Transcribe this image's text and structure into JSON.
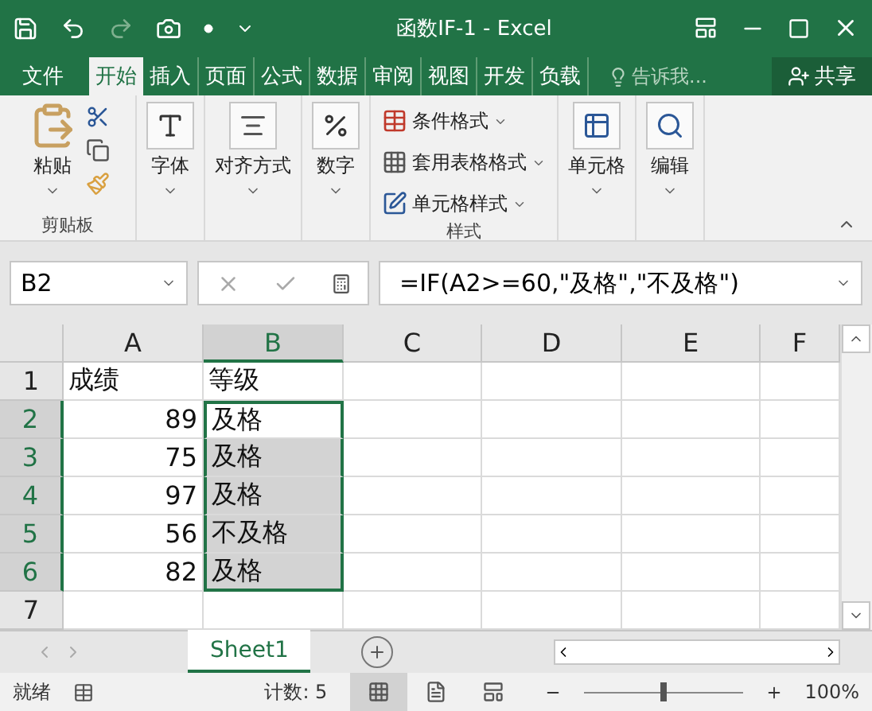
{
  "title": "函数IF-1 - Excel",
  "ribbon_tabs": [
    {
      "label": "文件",
      "selected": false
    },
    {
      "label": "开始",
      "selected": true
    },
    {
      "label": "插入",
      "selected": false
    },
    {
      "label": "页面",
      "selected": false
    },
    {
      "label": "公式",
      "selected": false
    },
    {
      "label": "数据",
      "selected": false
    },
    {
      "label": "审阅",
      "selected": false
    },
    {
      "label": "视图",
      "selected": false
    },
    {
      "label": "开发",
      "selected": false
    },
    {
      "label": "负载",
      "selected": false
    }
  ],
  "tell_me": "告诉我...",
  "share": "共享",
  "clipboard": {
    "paste": "粘贴",
    "group_label": "剪贴板"
  },
  "big_buttons": [
    {
      "kind": "font",
      "label": "字体"
    },
    {
      "kind": "align",
      "label": "对齐方式"
    },
    {
      "kind": "number",
      "label": "数字"
    }
  ],
  "styles": {
    "items": [
      {
        "kind": "conditional",
        "label": "条件格式"
      },
      {
        "kind": "table",
        "label": "套用表格格式"
      },
      {
        "kind": "cellstyle",
        "label": "单元格样式"
      }
    ],
    "group_label": "样式"
  },
  "tail_buttons": [
    {
      "kind": "cells",
      "label": "单元格"
    },
    {
      "kind": "edit",
      "label": "编辑"
    }
  ],
  "name_box": "B2",
  "formula": "=IF(A2>=60,\"及格\",\"不及格\")",
  "columns": [
    {
      "label": "A",
      "selected": false
    },
    {
      "label": "B",
      "selected": true
    },
    {
      "label": "C",
      "selected": false
    },
    {
      "label": "D",
      "selected": false
    },
    {
      "label": "E",
      "selected": false
    },
    {
      "label": "F",
      "selected": false
    }
  ],
  "rows": [
    {
      "label": "1",
      "selected": false,
      "cells": [
        {
          "text": "成绩",
          "kind": "text",
          "selected": false
        },
        {
          "text": "等级",
          "kind": "text",
          "selected": false
        }
      ]
    },
    {
      "label": "2",
      "selected": true,
      "cells": [
        {
          "text": "89",
          "kind": "number",
          "selected": false
        },
        {
          "text": "及格",
          "kind": "text",
          "selected": true,
          "active": true
        }
      ]
    },
    {
      "label": "3",
      "selected": true,
      "cells": [
        {
          "text": "75",
          "kind": "number",
          "selected": false
        },
        {
          "text": "及格",
          "kind": "text",
          "selected": true
        }
      ]
    },
    {
      "label": "4",
      "selected": true,
      "cells": [
        {
          "text": "97",
          "kind": "number",
          "selected": false
        },
        {
          "text": "及格",
          "kind": "text",
          "selected": true
        }
      ]
    },
    {
      "label": "5",
      "selected": true,
      "cells": [
        {
          "text": "56",
          "kind": "number",
          "selected": false
        },
        {
          "text": "不及格",
          "kind": "text",
          "selected": true
        }
      ]
    },
    {
      "label": "6",
      "selected": true,
      "cells": [
        {
          "text": "82",
          "kind": "number",
          "selected": false
        },
        {
          "text": "及格",
          "kind": "text",
          "selected": true
        }
      ]
    },
    {
      "label": "7",
      "selected": false,
      "cells": []
    }
  ],
  "sheets": [
    {
      "label": "Sheet1",
      "selected": true
    }
  ],
  "status": {
    "ready": "就绪",
    "count": "计数: 5",
    "zoom": "100%",
    "zoom_level": {
      "level": 0.5
    }
  }
}
